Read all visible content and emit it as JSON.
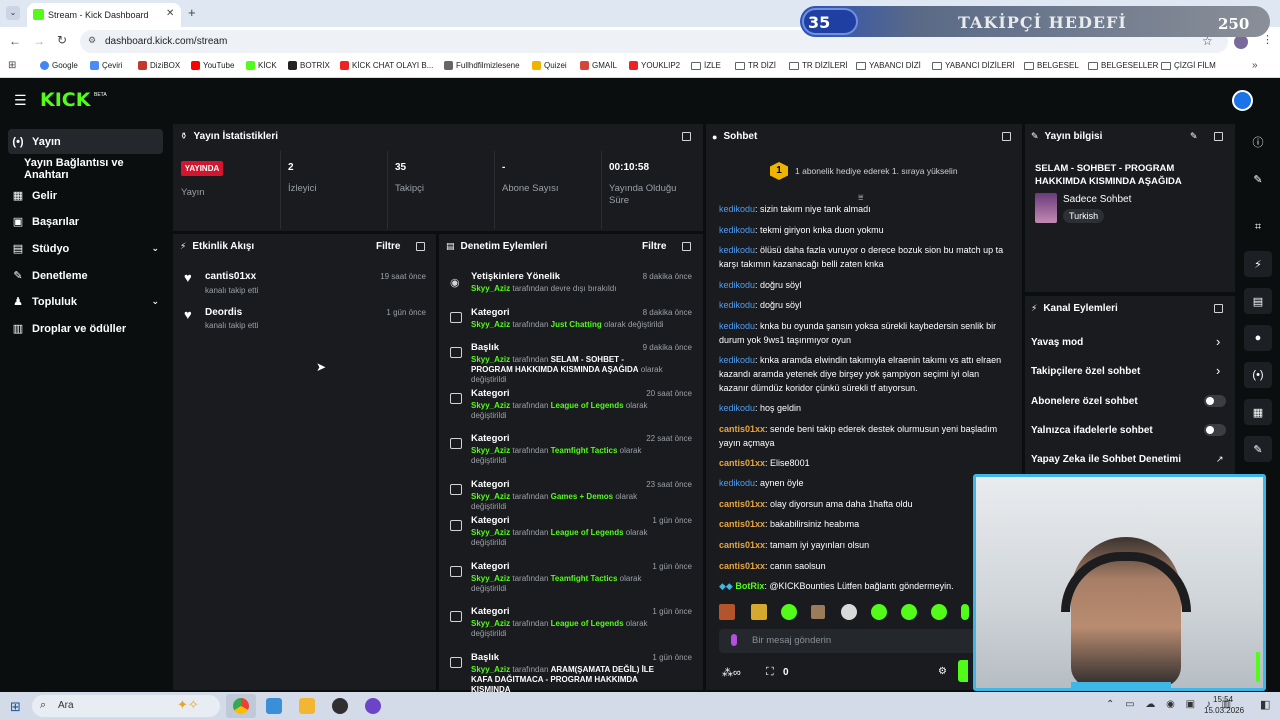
{
  "browser": {
    "tab_title": "Stream - Kick Dashboard",
    "url": "dashboard.kick.com/stream",
    "bookmarks": [
      "Google",
      "Çeviri",
      "DiziBOX",
      "YouTube",
      "KİCK",
      "BOTRİX",
      "KİCK CHAT OLAYI B...",
      "Fullhdfilmizlesene",
      "Quizei",
      "GMAİL",
      "YOUKLIP2",
      "İZLE",
      "TR DİZİ",
      "TR DİZİLERİ",
      "YABANCI DİZİ",
      "YABANCI DİZİLERİ",
      "BELGESEL",
      "BELGESELLER",
      "ÇİZGİ FİLM"
    ]
  },
  "overlay": {
    "goal_current": "35",
    "goal_label": "TAKİPÇİ HEDEFİ",
    "goal_target": "250"
  },
  "kick": {
    "logo": "KICK",
    "beta": "BETA"
  },
  "sidebar": {
    "items": [
      {
        "label": "Yayın",
        "icon": "live-icon"
      },
      {
        "label": "Yayın Bağlantısı ve Anahtarı",
        "icon": ""
      },
      {
        "label": "Gelir",
        "icon": "money-icon"
      },
      {
        "label": "Başarılar",
        "icon": "trophy-icon"
      },
      {
        "label": "Stüdyo",
        "icon": "studio-icon"
      },
      {
        "label": "Denetleme",
        "icon": "wrench-icon"
      },
      {
        "label": "Topluluk",
        "icon": "community-icon"
      },
      {
        "label": "Droplar ve ödüller",
        "icon": "drops-icon"
      }
    ]
  },
  "stats": {
    "title": "Yayın İstatistikleri",
    "live_badge": "YAYINDA",
    "live_label": "Yayın",
    "viewers_value": "2",
    "viewers_label": "İzleyici",
    "followers_value": "35",
    "followers_label": "Takipçi",
    "subs_value": "-",
    "subs_label": "Abone Sayısı",
    "uptime_value": "00:10:58",
    "uptime_label": "Yayında Olduğu Süre"
  },
  "activity": {
    "title": "Etkinlik Akışı",
    "filter": "Filtre",
    "items": [
      {
        "name": "cantis01xx",
        "sub": "kanalı takip etti",
        "time": "19 saat önce"
      },
      {
        "name": "Deordis",
        "sub": "kanalı takip etti",
        "time": "1 gün önce"
      }
    ]
  },
  "moderation": {
    "title": "Denetim Eylemleri",
    "filter": "Filtre",
    "items": [
      {
        "title": "Yetişkinlere Yönelik",
        "user": "Skyy_Aziz",
        "mid": " tarafından devre dışı bırakıldı",
        "value": "",
        "tail": "",
        "time": "8 dakika önce"
      },
      {
        "title": "Kategori",
        "user": "Skyy_Aziz",
        "mid": " tarafından ",
        "value": "Just Chatting",
        "tail": " olarak değiştirildi",
        "time": "8 dakika önce"
      },
      {
        "title": "Başlık",
        "user": "Skyy_Aziz",
        "mid": " tarafından ",
        "value": "SELAM - SOHBET - PROGRAM HAKKIMDA KISMINDA AŞAĞIDA",
        "tail": " olarak değiştirildi",
        "time": "9 dakika önce"
      },
      {
        "title": "Kategori",
        "user": "Skyy_Aziz",
        "mid": " tarafından ",
        "value": "League of Legends",
        "tail": " olarak değiştirildi",
        "time": "20 saat önce"
      },
      {
        "title": "Kategori",
        "user": "Skyy_Aziz",
        "mid": " tarafından ",
        "value": "Teamfight Tactics",
        "tail": " olarak değiştirildi",
        "time": "22 saat önce"
      },
      {
        "title": "Kategori",
        "user": "Skyy_Aziz",
        "mid": " tarafından ",
        "value": "Games + Demos",
        "tail": " olarak değiştirildi",
        "time": "23 saat önce"
      },
      {
        "title": "Kategori",
        "user": "Skyy_Aziz",
        "mid": " tarafından ",
        "value": "League of Legends",
        "tail": " olarak değiştirildi",
        "time": "1 gün önce"
      },
      {
        "title": "Kategori",
        "user": "Skyy_Aziz",
        "mid": " tarafından ",
        "value": "Teamfight Tactics",
        "tail": " olarak değiştirildi",
        "time": "1 gün önce"
      },
      {
        "title": "Kategori",
        "user": "Skyy_Aziz",
        "mid": " tarafından ",
        "value": "League of Legends",
        "tail": " olarak değiştirildi",
        "time": "1 gün önce"
      },
      {
        "title": "Başlık",
        "user": "Skyy_Aziz",
        "mid": " tarafından ",
        "value": "ARAM(ŞAMATA DEĞİL) İLE KAFA DAĞITMACA - PROGRAM HAKKIMDA KISMINDA",
        "tail": "",
        "time": "1 gün önce"
      }
    ]
  },
  "chat": {
    "title": "Sohbet",
    "pinned_badge": "1",
    "pinned_text": "1 abonelik hediye ederek 1. sıraya yükselin",
    "placeholder": "Bir mesaj gönderin",
    "count": "0",
    "messages": [
      {
        "user": "kedikodu",
        "text": ": sizin takım niye tank almadı",
        "style": "n1"
      },
      {
        "user": "kedikodu",
        "text": ": tekmi giriyon knka duon yokmu",
        "style": "n1"
      },
      {
        "user": "kedikodu",
        "text": ": ölüsü daha fazla vuruyor o derece bozuk sion bu match up ta karşı takımın kazanacağı belli zaten knka",
        "style": "n1"
      },
      {
        "user": "kedikodu",
        "text": ": doğru söyl",
        "style": "n1"
      },
      {
        "user": "kedikodu",
        "text": ": doğru söyl",
        "style": "n1"
      },
      {
        "user": "kedikodu",
        "text": ": knka bu oyunda şansın yoksa sürekli kaybedersin senlik bir durum yok 9ws1 taşınmıyor oyun",
        "style": "n1"
      },
      {
        "user": "kedikodu",
        "text": ": knka aramda elwindin takımıyla elraenin takımı vs attı elraen kazandı aramda yetenek diye birşey yok şampiyon seçimi iyi olan kazanır dümdüz koridor çünkü sürekli tf atıyorsun.",
        "style": "n1"
      },
      {
        "user": "kedikodu",
        "text": ": hoş geldin",
        "style": "n1"
      },
      {
        "user": "cantis01xx",
        "text": ": sende beni takip ederek destek olurmusun yeni başladım yayın açmaya",
        "style": "n2"
      },
      {
        "user": "cantis01xx",
        "text": ": Elise8001",
        "style": "n2"
      },
      {
        "user": "kedikodu",
        "text": ": aynen öyle",
        "style": "n1"
      },
      {
        "user": "cantis01xx",
        "text": ": olay diyorsun ama daha 1hafta oldu",
        "style": "n2"
      },
      {
        "user": "cantis01xx",
        "text": ": bakabilirsiniz heabıma",
        "style": "n2"
      },
      {
        "user": "cantis01xx",
        "text": ": tamam iyi yayınları olsun",
        "style": "n2"
      },
      {
        "user": "cantis01xx",
        "text": ": canın saolsun",
        "style": "n2"
      },
      {
        "user": "BotRix",
        "text": ": @KICKBounties Lütfen bağlantı göndermeyin.",
        "style": "n3"
      }
    ]
  },
  "stream_info": {
    "title": "Yayın bilgisi",
    "stream_title": "SELAM - SOHBET - PROGRAM HAKKIMDA KISMINDA AŞAĞIDA",
    "category": "Sadece Sohbet",
    "language": "Turkish"
  },
  "channel_actions": {
    "title": "Kanal Eylemleri",
    "items": [
      {
        "label": "Yavaş mod",
        "control": "arrow"
      },
      {
        "label": "Takipçilere özel sohbet",
        "control": "arrow"
      },
      {
        "label": "Abonelere özel sohbet",
        "control": "toggle"
      },
      {
        "label": "Yalnızca ifadelerle sohbet",
        "control": "toggle"
      },
      {
        "label": "Yapay Zeka ile Sohbet Denetimi",
        "control": "external"
      }
    ]
  },
  "taskbar": {
    "search": "Ara",
    "time": "15:54",
    "date": "15.03.2026"
  },
  "colors": {
    "accent": "#53fc18",
    "live": "#d4152e",
    "panel": "#191b1f",
    "background": "#0b0e0f"
  }
}
